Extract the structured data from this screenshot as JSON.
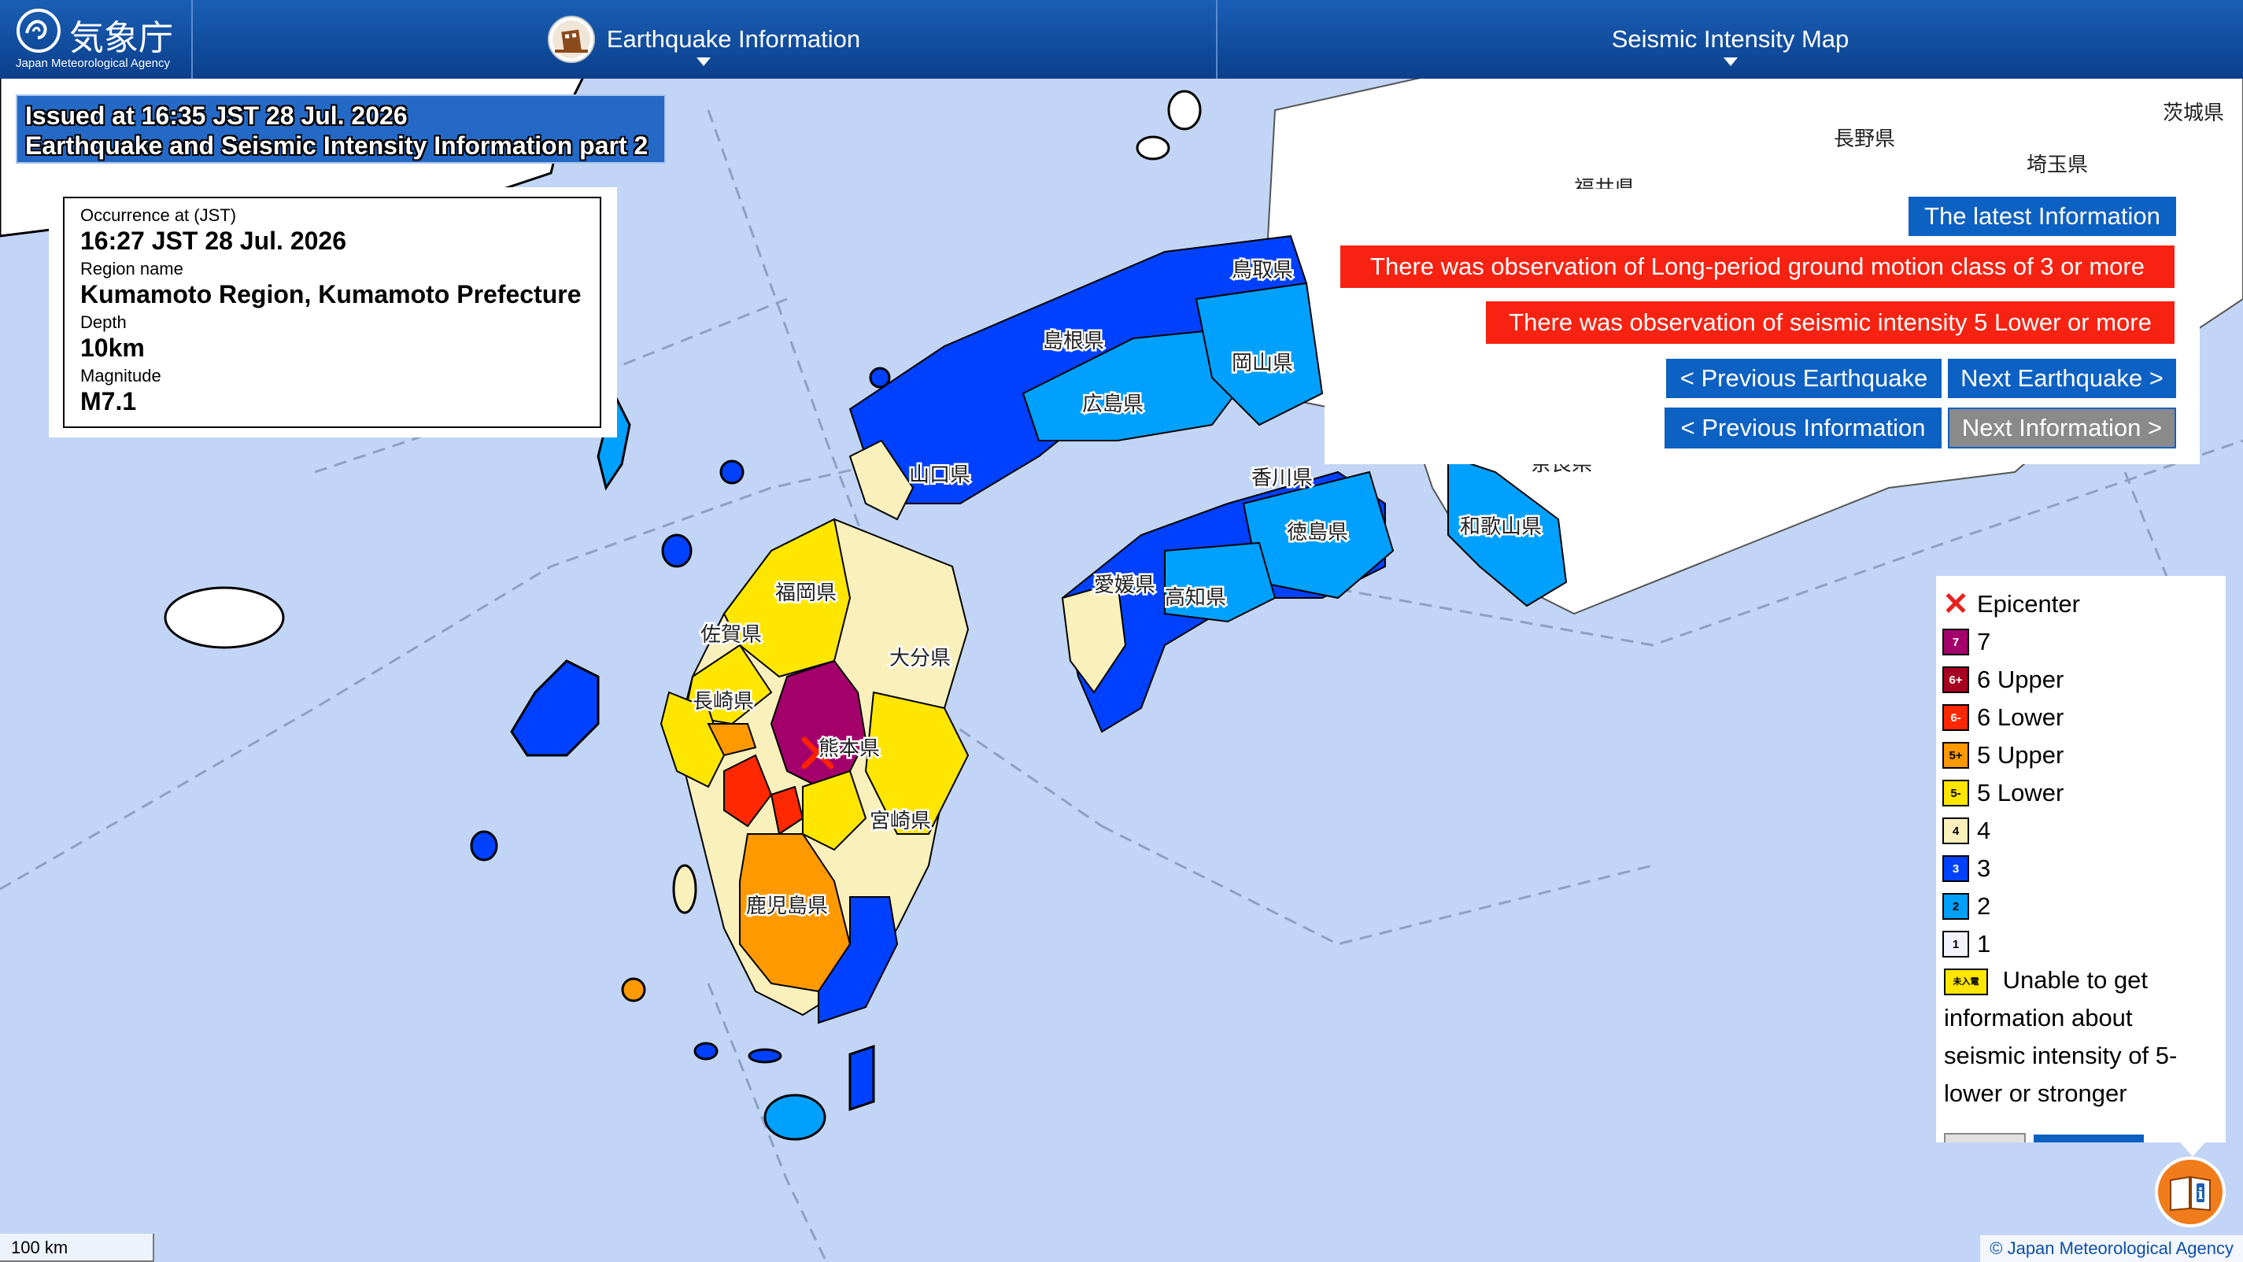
{
  "header": {
    "agency_jp": "気象庁",
    "agency_en": "Japan Meteorological Agency",
    "menu_earthquake": "Earthquake Information",
    "menu_map": "Seismic Intensity Map"
  },
  "issued": {
    "line1": "Issued at 16:35 JST 28 Jul. 2026",
    "line2": "Earthquake and Seismic Intensity Information part 2"
  },
  "occurrence": {
    "time_label": "Occurrence at (JST)",
    "time_value": "16:27 JST 28 Jul. 2026",
    "region_label": "Region name",
    "region_value": "Kumamoto Region, Kumamoto Prefecture",
    "depth_label": "Depth",
    "depth_value": "10km",
    "magnitude_label": "Magnitude",
    "magnitude_value": "M7.1"
  },
  "panel": {
    "latest": "The latest Information",
    "alert_long_period": "There was observation of Long-period ground motion class of 3 or more",
    "alert_intensity": "There was observation of seismic intensity 5 Lower or more",
    "prev_earthquake": "< Previous Earthquake",
    "next_earthquake": "Next Earthquake >",
    "prev_info": "< Previous Information",
    "next_info": "Next Information >"
  },
  "legend": {
    "epicenter": "Epicenter",
    "items": [
      {
        "badge": "7",
        "label": "7",
        "color": "#a3006b",
        "text_color": "#ffffff"
      },
      {
        "badge": "6+",
        "label": "6 Upper",
        "color": "#a50021",
        "text_color": "#ffffff"
      },
      {
        "badge": "6-",
        "label": "6 Lower",
        "color": "#ff2800",
        "text_color": "#ffffff"
      },
      {
        "badge": "5+",
        "label": "5 Upper",
        "color": "#ff9900",
        "text_color": "#000000"
      },
      {
        "badge": "5-",
        "label": "5 Lower",
        "color": "#ffe600",
        "text_color": "#000000"
      },
      {
        "badge": "4",
        "label": "4",
        "color": "#faf0bc",
        "text_color": "#000000"
      },
      {
        "badge": "3",
        "label": "3",
        "color": "#0041ff",
        "text_color": "#ffffff"
      },
      {
        "badge": "2",
        "label": "2",
        "color": "#00a0ff",
        "text_color": "#000000"
      },
      {
        "badge": "1",
        "label": "1",
        "color": "#f2f2ff",
        "text_color": "#000000"
      }
    ],
    "unknown_badge": "未入電",
    "unknown_text": "Unable to get information about seismic intensity of 5-lower or stronger"
  },
  "map": {
    "scale": "100 km",
    "copyright": "© Japan Meteorological Agency",
    "prefectures": [
      "鳥取県",
      "島根県",
      "岡山県",
      "広島県",
      "山口県",
      "香川県",
      "徳島県",
      "愛媛県",
      "高知県",
      "福岡県",
      "佐賀県",
      "長崎県",
      "大分県",
      "熊本県",
      "宮崎県",
      "鹿児島県",
      "和歌山県",
      "長野県",
      "埼玉県",
      "茨城県",
      "福井県",
      "奈良県"
    ],
    "intensity_colors": {
      "i7": "#a3006b",
      "i6l": "#ff2800",
      "i5u": "#ff9900",
      "i5l": "#ffe600",
      "i4": "#faf0bc",
      "i3": "#0041ff",
      "i2": "#00a0ff",
      "i1": "#f2f2ff",
      "sea": "#c2d5f6",
      "land": "#ffffff"
    }
  }
}
